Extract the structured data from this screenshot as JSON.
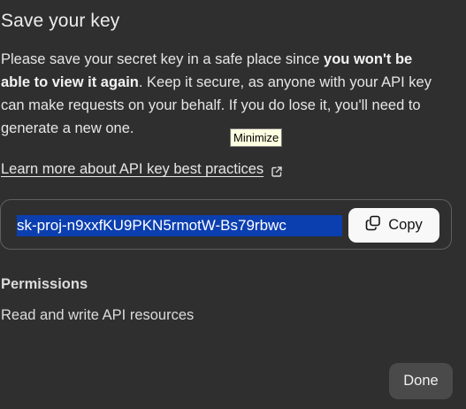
{
  "dialog": {
    "title": "Save your key",
    "description": {
      "part1": "Please save your secret key in a safe place since ",
      "bold1": "you won't be able to view it again",
      "part2": ". Keep it secure, as anyone with your API key can make requests on your behalf. If you do lose it, you'll need to generate a new one."
    },
    "learn_more_link": "Learn more about API key best practices",
    "key_value": "sk-proj-n9xxfKU9PKN5rmotW-Bs79rbwc",
    "copy_label": "Copy",
    "permissions_heading": "Permissions",
    "permissions_value": "Read and write API resources",
    "done_label": "Done"
  },
  "tooltip": {
    "text": "Minimize"
  },
  "icons": {
    "external_link": "external-link-icon",
    "copy": "copy-icon"
  },
  "colors": {
    "background": "#2f2f2f",
    "text": "#ececec",
    "selection": "#0b3fb0",
    "copy_button_bg": "#f8f8f8",
    "done_button_bg": "#4a4a4a",
    "tooltip_bg": "#ffffe1"
  }
}
